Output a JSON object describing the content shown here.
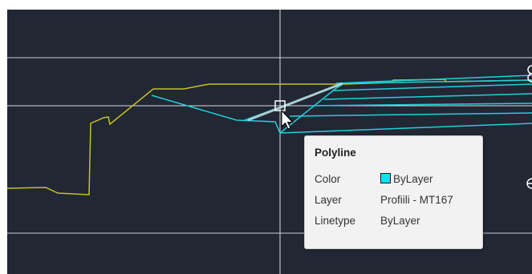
{
  "colors": {
    "canvas_background": "#212733",
    "crosshair": "#d9dde4",
    "terrain_line": "#c8c21a",
    "profile_lines": "#1fd0dc",
    "selected_segment": "#b8d6da",
    "bylayer_swatch": "#00e5ef"
  },
  "tooltip": {
    "title": "Polyline",
    "rows": [
      {
        "label": "Color",
        "value": "ByLayer",
        "swatch": "cyan-color-swatch"
      },
      {
        "label": "Layer",
        "value": "Profiili - MT167"
      },
      {
        "label": "Linetype",
        "value": "ByLayer"
      }
    ]
  },
  "cursor": {
    "pickbox": "square-pickbox",
    "pointer": "arrow-cursor-icon"
  },
  "edge_glyphs": [
    "partial-symbol-top-right-icon",
    "partial-symbol-right-icon"
  ]
}
